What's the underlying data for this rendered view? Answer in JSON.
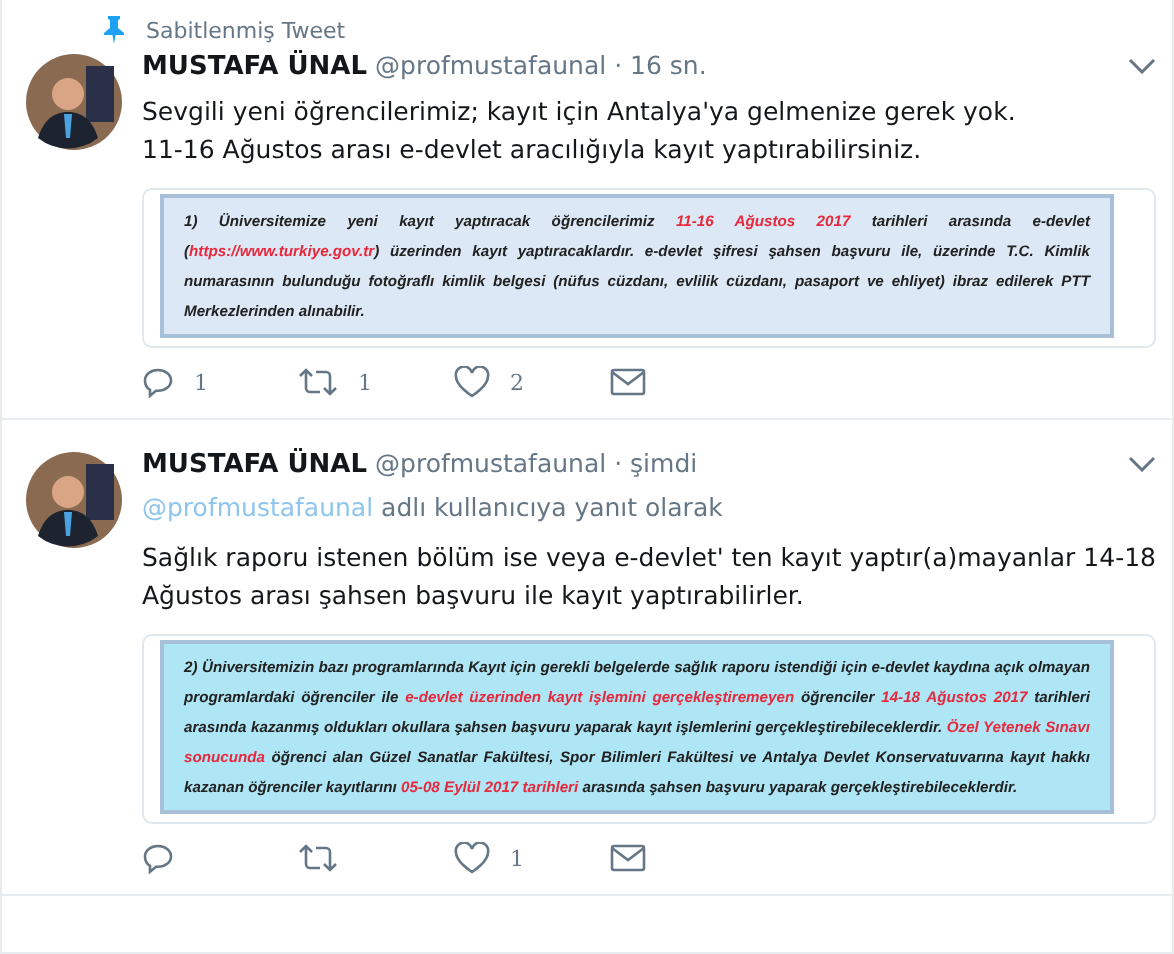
{
  "tweets": [
    {
      "pinned_label": "Sabitlenmiş Tweet",
      "name": "MUSTAFA ÜNAL",
      "handle": "@profmustafaunal",
      "time": "· 16 sn.",
      "lines": [
        "Sevgili yeni öğrencilerimiz; kayıt için Antalya'ya gelmenize gerek yok.",
        "11-16 Ağustos arası e-devlet aracılığıyla kayıt yaptırabilirsiniz."
      ],
      "image": {
        "color": "#dce8f5",
        "segments": [
          {
            "text": "1) Üniversitemize yeni kayıt yaptıracak öğrencilerimiz ",
            "red": false
          },
          {
            "text": "11-16 Ağustos 2017",
            "red": true
          },
          {
            "text": " tarihleri arasında e-devlet (",
            "red": false
          },
          {
            "text": "https://www.turkiye.gov.tr",
            "red": true
          },
          {
            "text": ") üzerinden kayıt yaptıracaklardır. e-devlet şifresi şahsen başvuru ile, üzerinde T.C. Kimlik numarasının bulunduğu fotoğraflı kimlik belgesi (nüfus cüzdanı, evlilik cüzdanı, pasaport ve ehliyet) ibraz edilerek PTT Merkezlerinden alınabilir.",
            "red": false
          }
        ]
      },
      "actions": [
        {
          "kind": "reply",
          "count": "1"
        },
        {
          "kind": "retweet",
          "count": "1"
        },
        {
          "kind": "like",
          "count": "2"
        },
        {
          "kind": "mail"
        }
      ]
    },
    {
      "name": "MUSTAFA ÜNAL",
      "handle": "@profmustafaunal",
      "time": "· şimdi",
      "reply_to": {
        "handle": "@profmustafaunal",
        "text": " adlı kullanıcıya yanıt olarak"
      },
      "lines": [
        "Sağlık raporu istenen bölüm ise veya e-devlet' ten kayıt yaptır(a)mayanlar 14-18 Ağustos arası şahsen başvuru ile kayıt yaptırabilirler."
      ],
      "image": {
        "color": "#aee6f5",
        "segments": [
          {
            "text": "2) Üniversitemizin bazı programlarında Kayıt için gerekli belgelerde sağlık raporu istendiği için e-devlet kaydına açık olmayan programlardaki öğrenciler ile ",
            "red": false
          },
          {
            "text": "e-devlet üzerinden kayıt işlemini gerçekleştiremeyen",
            "red": true
          },
          {
            "text": " öğrenciler ",
            "red": false
          },
          {
            "text": "14-18 Ağustos 2017",
            "red": true
          },
          {
            "text": " tarihleri arasında kazanmış oldukları okullara şahsen başvuru yaparak kayıt işlemlerini gerçekleştirebileceklerdir. ",
            "red": false
          },
          {
            "text": "Özel Yetenek Sınavı sonucunda",
            "red": true
          },
          {
            "text": " öğrenci alan Güzel Sanatlar Fakültesi, Spor Bilimleri Fakültesi ve Antalya Devlet Konservatuvarına kayıt hakkı kazanan öğrenciler kayıtlarını ",
            "red": false
          },
          {
            "text": "05-08 Eylül 2017 tarihleri",
            "red": true
          },
          {
            "text": " arasında şahsen başvuru yaparak gerçekleştirebileceklerdir.",
            "red": false
          }
        ]
      },
      "actions": [
        {
          "kind": "reply"
        },
        {
          "kind": "retweet"
        },
        {
          "kind": "like",
          "count": "1"
        },
        {
          "kind": "mail"
        }
      ]
    }
  ]
}
